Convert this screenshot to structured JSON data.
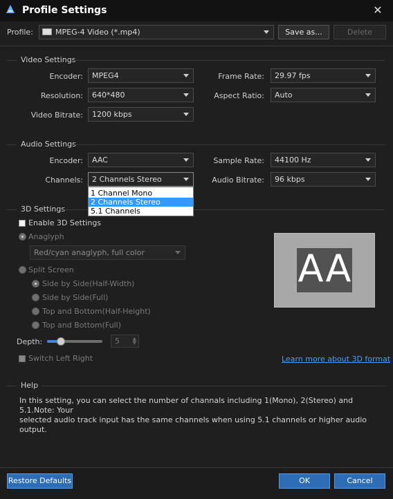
{
  "window": {
    "title": "Profile Settings",
    "icon": "app-logo-icon",
    "close": "✕"
  },
  "profile": {
    "label": "Profile:",
    "value": "MPEG-4 Video (*.mp4)",
    "save_as": "Save as...",
    "delete": "Delete"
  },
  "video": {
    "section": "Video Settings",
    "encoder_label": "Encoder:",
    "encoder": "MPEG4",
    "framerate_label": "Frame Rate:",
    "framerate": "29.97 fps",
    "resolution_label": "Resolution:",
    "resolution": "640*480",
    "aspect_label": "Aspect Ratio:",
    "aspect": "Auto",
    "bitrate_label": "Video Bitrate:",
    "bitrate": "1200 kbps"
  },
  "audio": {
    "section": "Audio Settings",
    "encoder_label": "Encoder:",
    "encoder": "AAC",
    "samplerate_label": "Sample Rate:",
    "samplerate": "44100 Hz",
    "channels_label": "Channels:",
    "channels": "2 Channels Stereo",
    "bitrate_label": "Audio Bitrate:",
    "bitrate": "96 kbps",
    "channel_options": [
      "1 Channel Mono",
      "2 Channels Stereo",
      "5.1 Channels"
    ],
    "selected_option_index": 1
  },
  "three_d": {
    "section": "3D Settings",
    "enable": "Enable 3D Settings",
    "anaglyph": "Anaglyph",
    "anaglyph_mode": "Red/cyan anaglyph, full color",
    "split_screen": "Split Screen",
    "options": [
      "Side by Side(Half-Width)",
      "Side by Side(Full)",
      "Top and Bottom(Half-Height)",
      "Top and Bottom(Full)"
    ],
    "depth_label": "Depth:",
    "depth_value": "5",
    "depth_fraction": 0.25,
    "switch": "Switch Left Right",
    "learn_more": "Learn more about 3D format",
    "preview_text": [
      "A",
      "A"
    ]
  },
  "help": {
    "section": "Help",
    "text_line1": "In this setting, you can select the number of channals including 1(Mono), 2(Stereo) and 5.1.Note: Your",
    "text_line2": "selected audio track input has the same channels when using 5.1 channels or higher audio output."
  },
  "footer": {
    "restore": "Restore Defaults",
    "ok": "OK",
    "cancel": "Cancel"
  },
  "colors": {
    "accent_blue": "#2d6db5",
    "selection": "#3399ff",
    "link": "#4a9cff"
  }
}
